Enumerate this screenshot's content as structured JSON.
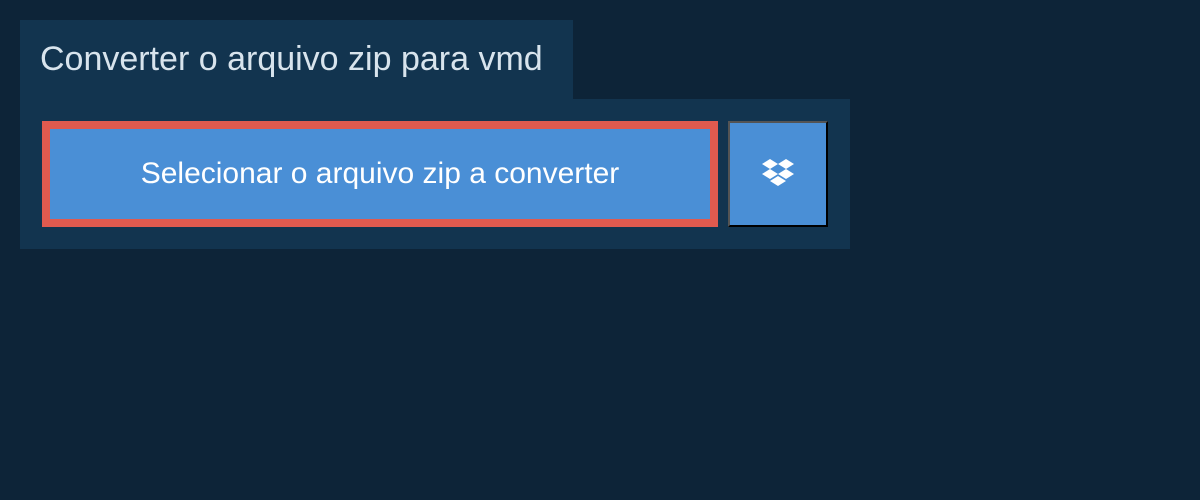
{
  "header": {
    "title": "Converter o arquivo zip para vmd"
  },
  "actions": {
    "select_file_label": "Selecionar o arquivo zip a converter"
  },
  "colors": {
    "background": "#0d2438",
    "panel": "#12344f",
    "button_primary": "#4a8fd6",
    "highlight_border": "#e05a4f",
    "text_light": "#d8e4ed"
  }
}
